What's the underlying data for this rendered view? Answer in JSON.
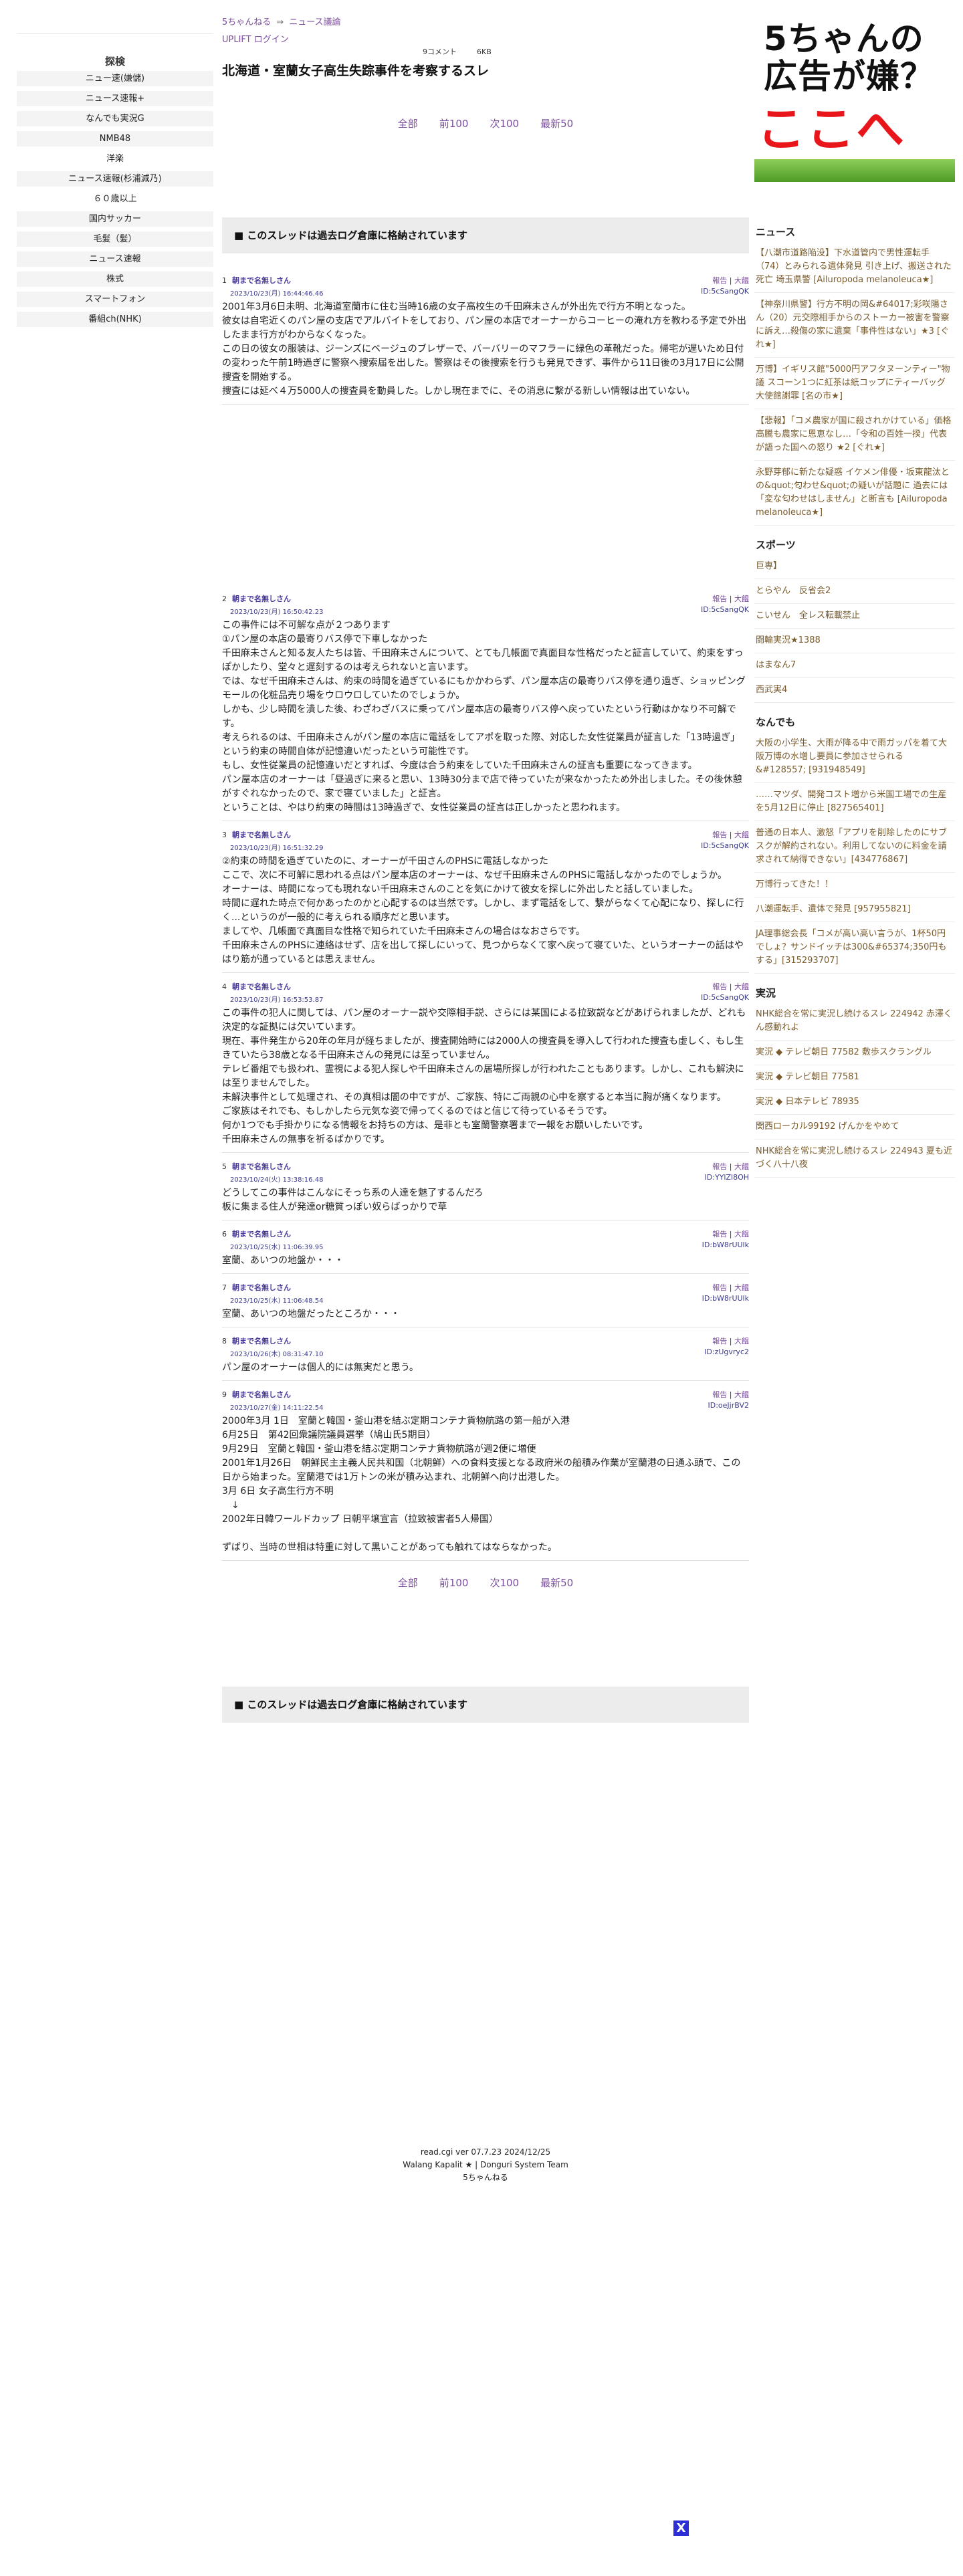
{
  "left_sidebar": {
    "heading": "探検",
    "items": [
      {
        "label": "ニュー速(嫌儲)",
        "white": false
      },
      {
        "label": "ニュース速報+",
        "white": false
      },
      {
        "label": "なんでも実況G",
        "white": false
      },
      {
        "label": "NMB48",
        "white": false
      },
      {
        "label": "洋楽",
        "white": true
      },
      {
        "label": "ニュース速報(杉浦減乃)",
        "white": false
      },
      {
        "label": "６０歳以上",
        "white": true
      },
      {
        "label": "国内サッカー",
        "white": false
      },
      {
        "label": "毛髪（髪）",
        "white": false
      },
      {
        "label": "ニュース速報",
        "white": false
      },
      {
        "label": "株式",
        "white": false
      },
      {
        "label": "スマートフォン",
        "white": false
      },
      {
        "label": "番組ch(NHK)",
        "white": false
      }
    ]
  },
  "breadcrumb": {
    "home": "5ちゃんねる",
    "arrow": "⇒",
    "board": "ニュース議論",
    "login": "UPLIFT ログイン"
  },
  "thread_meta": {
    "comments": "9コメント",
    "size": "6KB"
  },
  "thread_title": "北海道・室蘭女子高生失踪事件を考察するスレ",
  "nav": {
    "all": "全部",
    "prev": "前100",
    "next": "次100",
    "latest": "最新50"
  },
  "archive_notice": "■ このスレッドは過去ログ倉庫に格納されています",
  "post_tools": {
    "report": "報告",
    "sep": "|",
    "expand": "大饂"
  },
  "posts": [
    {
      "num": "1",
      "name": "朝まで名無しさん",
      "date": "2023/10/23(月) 16:44:46.46",
      "id": "ID:5cSangQK",
      "body": "2001年3月6日未明、北海道室蘭市に住む当時16歳の女子高校生の千田麻未さんが外出先で行方不明となった。\n彼女は自宅近くのパン屋の支店でアルバイトをしており、パン屋の本店でオーナーからコーヒーの淹れ方を教わる予定で外出したまま行方がわからなくなった。\nこの日の彼女の服装は、ジーンズにベージュのブレザーで、バーバリーのマフラーに緑色の革靴だった。帰宅が遅いため日付の変わった午前1時過ぎに警察へ捜索届を出した。警察はその後捜索を行うも発見できず、事件から11日後の3月17日に公開捜査を開始する。\n捜査には延べ４万5000人の捜査員を動員した。しかし現在までに、その消息に繋がる新しい情報は出ていない。"
    },
    {
      "num": "2",
      "name": "朝まで名無しさん",
      "date": "2023/10/23(月) 16:50:42.23",
      "id": "ID:5cSangQK",
      "body": "この事件には不可解な点が２つあります\n①パン屋の本店の最寄りバス停で下車しなかった\n千田麻未さんと知る友人たちは皆、千田麻未さんについて、とても几帳面で真面目な性格だったと証言していて、約束をすっぽかしたり、堂々と遅刻するのは考えられないと言います。\nでは、なぜ千田麻未さんは、約束の時間を過ぎているにもかかわらず、パン屋本店の最寄りバス停を通り過ぎ、ショッピングモールの化粧品売り場をウロウロしていたのでしょうか。\nしかも、少し時間を潰した後、わざわざバスに乗ってパン屋本店の最寄りバス停へ戻っていたという行動はかなり不可解です。\n考えられるのは、千田麻未さんがパン屋の本店に電話をしてアポを取った際、対応した女性従業員が証言した「13時過ぎ」という約束の時間自体が記憶違いだったという可能性です。\nもし、女性従業員の記憶違いだとすれば、今度は合う約束をしていた千田麻未さんの証言も重要になってきます。\nパン屋本店のオーナーは「昼過ぎに来ると思い、13時30分まで店で待っていたが来なかったため外出しました。その後休憩がすぐれなかったので、家で寝ていました」と証言。\nということは、やはり約束の時間は13時過ぎで、女性従業員の証言は正しかったと思われます。"
    },
    {
      "num": "3",
      "name": "朝まで名無しさん",
      "date": "2023/10/23(月) 16:51:32.29",
      "id": "ID:5cSangQK",
      "body": "②約束の時間を過ぎていたのに、オーナーが千田さんのPHSに電話しなかった\nここで、次に不可解に思われる点はパン屋本店のオーナーは、なぜ千田麻未さんのPHSに電話しなかったのでしょうか。\nオーナーは、時間になっても現れない千田麻未さんのことを気にかけて彼女を探しに外出したと話していました。\n時間に遅れた時点で何かあったのかと心配するのは当然です。しかし、まず電話をして、繋がらなくて心配になり、探しに行く...というのが一般的に考えられる順序だと思います。\nましてや、几帳面で真面目な性格で知られていた千田麻未さんの場合はなおさらです。\n千田麻未さんのPHSに連絡はせず、店を出して探しにいって、見つからなくて家へ戻って寝ていた、というオーナーの話はやはり筋が通っているとは思えません。"
    },
    {
      "num": "4",
      "name": "朝まで名無しさん",
      "date": "2023/10/23(月) 16:53:53.87",
      "id": "ID:5cSangQK",
      "body": "この事件の犯人に関しては、パン屋のオーナー説や交際相手説、さらには某国による拉致説などがあげられましたが、どれも決定的な証拠には欠いています。\n現在、事件発生から20年の年月が経ちましたが、捜査開始時には2000人の捜査員を導入して行われた捜査も虚しく、もし生きていたら38歳となる千田麻未さんの発見には至っていません。\nテレビ番組でも扱われ、霊視による犯人探しや千田麻未さんの居場所探しが行われたこともあります。しかし、これも解決には至りませんでした。\n未解決事件として処理され、その真相は闇の中ですが、ご家族、特にご両親の心中を察すると本当に胸が痛くなります。\nご家族はそれでも、もしかしたら元気な姿で帰ってくるのではと信じて待っているそうです。\n何か1つでも手掛かりになる情報をお持ちの方は、是非とも室蘭警察署まで一報をお願いしたいです。\n千田麻未さんの無事を祈るばかりです。"
    },
    {
      "num": "5",
      "name": "朝まで名無しさん",
      "date": "2023/10/24(火) 13:38:16.48",
      "id": "ID:YYlZl8OH",
      "body": "どうしてこの事件はこんなにそっち系の人達を魅了するんだろ\n板に集まる住人が発達or糖質っぽい奴らばっかりで草"
    },
    {
      "num": "6",
      "name": "朝まで名無しさん",
      "date": "2023/10/25(水) 11:06:39.95",
      "id": "ID:bW8rUUlk",
      "body": "室蘭、あいつの地盤か・・・"
    },
    {
      "num": "7",
      "name": "朝まで名無しさん",
      "date": "2023/10/25(水) 11:06:48.54",
      "id": "ID:bW8rUUlk",
      "body": "室蘭、あいつの地盤だったところか・・・"
    },
    {
      "num": "8",
      "name": "朝まで名無しさん",
      "date": "2023/10/26(木) 08:31:47.10",
      "id": "ID:zUgvryc2",
      "body": "パン屋のオーナーは個人的には無実だと思う。"
    },
    {
      "num": "9",
      "name": "朝まで名無しさん",
      "date": "2023/10/27(金) 14:11:22.54",
      "id": "ID:oeJjrBV2",
      "body": "2000年3月 1日　室蘭と韓国・釜山港を結ぶ定期コンテナ貨物航路の第一船が入港\n6月25日　第42回衆議院議員選挙（鳩山氏5期目）\n9月29日　室蘭と韓国・釜山港を結ぶ定期コンテナ貨物航路が週2便に増便\n2001年1月26日　朝鮮民主主義人民共和国（北朝鮮）への食料支援となる政府米の船積み作業が室蘭港の日通ふ頭で、この日から始まった。室蘭港では1万トンの米が積み込まれ、北朝鮮へ向け出港した。\n3月 6日 女子高生行方不明\n　↓\n2002年日韓ワールドカップ 日朝平壌宣言（拉致被害者5人帰国）\n\nずばり、当時の世相は特重に対して黒いことがあっても触れてはならなかった。"
    }
  ],
  "footer": {
    "line1": "read.cgi ver 07.7.23 2024/12/25",
    "line2": "Walang Kapalit ★ | Donguri System Team",
    "line3": "5ちゃんねる"
  },
  "right_sidebar": {
    "ad": {
      "line1": "5ちゃんの",
      "line2": "広告が嫌？",
      "line3": "ここへ"
    },
    "sections": [
      {
        "heading": "ニュース",
        "items": [
          "【八潮市道路陥没】下水道管内で男性運転手（74）とみられる遺体発見 引き上げ、搬送された 死亡 埼玉県警 [Ailuropoda melanoleuca★]",
          "【神奈川県警】行方不明の岡&#64017;彩咲陽さん（20）元交際相手からのストーカー被害を警察に訴え…殺傷の家に遺棄「事件性はない」★3 [ぐれ★]",
          "万博】イギリス館\"5000円アフタヌーンティー\"物議 スコーン1つに紅茶は紙コップにティーバッグ 大使館謝罪 [名の市★]",
          "【悲報】「コメ農家が国に殺されかけている」価格高騰も農家に恩恵なし…「令和の百姓一揆」代表が語った国への怒り ★2 [ぐれ★]",
          "永野芽郁に新たな疑惑 イケメン俳優・坂東龍汰との&quot;匂わせ&quot;の疑いが話題に 過去には「変な匂わせはしません」と断言も [Ailuropoda melanoleuca★]"
        ]
      },
      {
        "heading": "スポーツ",
        "items": [
          "巨専】",
          "とらやん　反省会2",
          "こいせん　全レス転載禁止",
          "闘輪実況★1388",
          "はまなん7",
          "西武実4"
        ]
      },
      {
        "heading": "なんでも",
        "items": [
          "大阪の小学生、大雨が降る中で雨ガッパを着て大阪万博の水増し要員に参加させられる &#128557; [931948549]",
          "……マツダ、開発コスト増から米国工場での生産を5月12日に停止 [827565401]",
          "普通の日本人、激怒「アプリを削除したのにサブスクが解約されない。利用してないのに料金を請求されて納得できない」[434776867]",
          "万博行ってきた！！",
          "八潮運転手、遺体で発見 [957955821]",
          "JA理事総会長「コメが高い高い言うが、1杯50円でしょ？サンドイッチは300&#65374;350円もする」[315293707]"
        ]
      },
      {
        "heading": "実況",
        "items": [
          "NHK総合を常に実況し続けるスレ 224942 赤澤くん感動れよ",
          "実況 ◆ テレビ朝日 77582 敷歩スクラングル",
          "実況 ◆ テレビ朝日 77581",
          "実況 ◆ 日本テレビ 78935",
          "関西ローカル99192 げんかをやめて",
          "NHK総合を常に実況し続けるスレ 224943 夏も近づく八十八夜"
        ]
      }
    ]
  },
  "close_button": "X",
  "colors": {
    "link": "#7b4f9d",
    "post_name": "#4b3a9c",
    "ad_red": "#e8151b",
    "sidebar_link": "#7a5c2e",
    "close_bg": "#2e2ed6"
  }
}
